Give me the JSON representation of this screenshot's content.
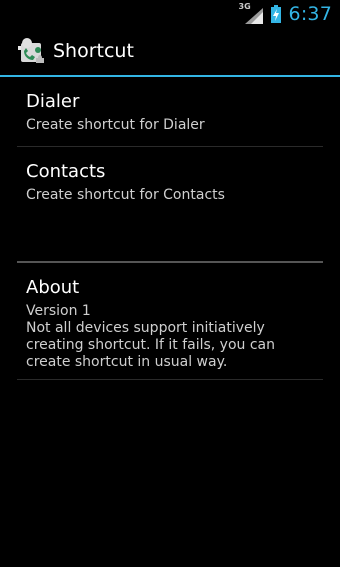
{
  "status_bar": {
    "network_type": "3G",
    "time": "6:37",
    "icons": [
      "signal-icon",
      "battery-charging-icon"
    ]
  },
  "action_bar": {
    "title": "Shortcut",
    "icon": "app-shortcut-icon"
  },
  "prefs": [
    {
      "title": "Dialer",
      "summary": "Create shortcut for Dialer"
    },
    {
      "title": "Contacts",
      "summary": "Create shortcut for Contacts"
    }
  ],
  "about": {
    "title": "About",
    "version": "Version 1",
    "description": "Not all devices support initiatively creating shortcut. If it fails, you can create shortcut in usual way."
  },
  "colors": {
    "accent": "#33b5e5",
    "background": "#000000"
  }
}
